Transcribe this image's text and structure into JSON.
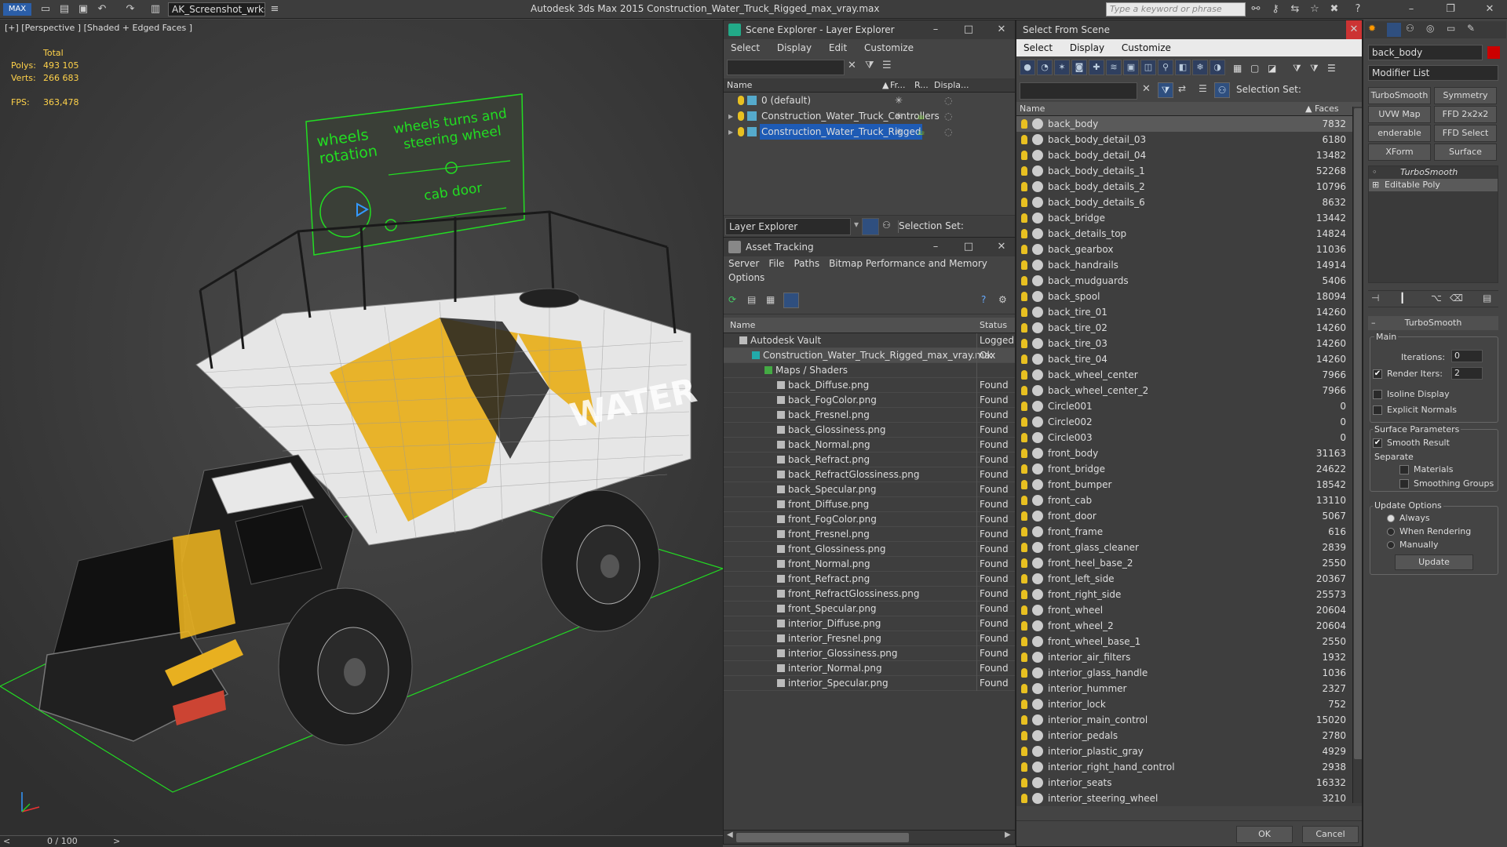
{
  "titlebar": {
    "workspace": "AK_Screenshot_wrksp",
    "app_title": "Autodesk 3ds Max  2015     Construction_Water_Truck_Rigged_max_vray.max",
    "search_placeholder": "Type a keyword or phrase"
  },
  "viewport": {
    "label": "[+] [Perspective ] [Shaded + Edged Faces ]",
    "stats": {
      "total_label": "Total",
      "polys_label": "Polys:",
      "polys": "493 105",
      "verts_label": "Verts:",
      "verts": "266 683",
      "fps_label": "FPS:",
      "fps": "363,478"
    },
    "panel_texts": {
      "wheels_rotation": "wheels rotation",
      "wheels_turns": "wheels turns and steering wheel",
      "cab_door": "cab door"
    },
    "truck_label": "WATER"
  },
  "statusbar": {
    "frame": "0 / 100"
  },
  "scene_explorer": {
    "title": "Scene Explorer - Layer Explorer",
    "menu": [
      "Select",
      "Display",
      "Edit",
      "Customize"
    ],
    "columns": [
      "Name",
      "Fr...",
      "R...",
      "Displa..."
    ],
    "layers": [
      {
        "name": "0 (default)",
        "selected": false
      },
      {
        "name": "Construction_Water_Truck_Controllers",
        "selected": false
      },
      {
        "name": "Construction_Water_Truck_Rigged",
        "selected": true
      }
    ],
    "footer_dropdown": "Layer Explorer",
    "selection_set_label": "Selection Set:"
  },
  "asset_tracking": {
    "title": "Asset Tracking",
    "menu": [
      "Server",
      "File",
      "Paths",
      "Bitmap Performance and Memory",
      "Options"
    ],
    "columns": [
      "Name",
      "Status"
    ],
    "rows": [
      {
        "name": "Autodesk Vault",
        "status": "Logged",
        "indent": 1
      },
      {
        "name": "Construction_Water_Truck_Rigged_max_vray.max",
        "status": "Ok",
        "indent": 2
      },
      {
        "name": "Maps / Shaders",
        "status": "",
        "indent": 3
      },
      {
        "name": "back_Diffuse.png",
        "status": "Found",
        "indent": 4
      },
      {
        "name": "back_FogColor.png",
        "status": "Found",
        "indent": 4
      },
      {
        "name": "back_Fresnel.png",
        "status": "Found",
        "indent": 4
      },
      {
        "name": "back_Glossiness.png",
        "status": "Found",
        "indent": 4
      },
      {
        "name": "back_Normal.png",
        "status": "Found",
        "indent": 4
      },
      {
        "name": "back_Refract.png",
        "status": "Found",
        "indent": 4
      },
      {
        "name": "back_RefractGlossiness.png",
        "status": "Found",
        "indent": 4
      },
      {
        "name": "back_Specular.png",
        "status": "Found",
        "indent": 4
      },
      {
        "name": "front_Diffuse.png",
        "status": "Found",
        "indent": 4
      },
      {
        "name": "front_FogColor.png",
        "status": "Found",
        "indent": 4
      },
      {
        "name": "front_Fresnel.png",
        "status": "Found",
        "indent": 4
      },
      {
        "name": "front_Glossiness.png",
        "status": "Found",
        "indent": 4
      },
      {
        "name": "front_Normal.png",
        "status": "Found",
        "indent": 4
      },
      {
        "name": "front_Refract.png",
        "status": "Found",
        "indent": 4
      },
      {
        "name": "front_RefractGlossiness.png",
        "status": "Found",
        "indent": 4
      },
      {
        "name": "front_Specular.png",
        "status": "Found",
        "indent": 4
      },
      {
        "name": "interior_Diffuse.png",
        "status": "Found",
        "indent": 4
      },
      {
        "name": "interior_Fresnel.png",
        "status": "Found",
        "indent": 4
      },
      {
        "name": "interior_Glossiness.png",
        "status": "Found",
        "indent": 4
      },
      {
        "name": "interior_Normal.png",
        "status": "Found",
        "indent": 4
      },
      {
        "name": "interior_Specular.png",
        "status": "Found",
        "indent": 4
      }
    ]
  },
  "select_from_scene": {
    "title": "Select From Scene",
    "menu": [
      "Select",
      "Display",
      "Customize"
    ],
    "selection_set_label": "Selection Set:",
    "columns": [
      "Name",
      "Faces"
    ],
    "rows": [
      {
        "name": "back_body",
        "faces": "7832"
      },
      {
        "name": "back_body_detail_03",
        "faces": "6180"
      },
      {
        "name": "back_body_detail_04",
        "faces": "13482"
      },
      {
        "name": "back_body_details_1",
        "faces": "52268"
      },
      {
        "name": "back_body_details_2",
        "faces": "10796"
      },
      {
        "name": "back_body_details_6",
        "faces": "8632"
      },
      {
        "name": "back_bridge",
        "faces": "13442"
      },
      {
        "name": "back_details_top",
        "faces": "14824"
      },
      {
        "name": "back_gearbox",
        "faces": "11036"
      },
      {
        "name": "back_handrails",
        "faces": "14914"
      },
      {
        "name": "back_mudguards",
        "faces": "5406"
      },
      {
        "name": "back_spool",
        "faces": "18094"
      },
      {
        "name": "back_tire_01",
        "faces": "14260"
      },
      {
        "name": "back_tire_02",
        "faces": "14260"
      },
      {
        "name": "back_tire_03",
        "faces": "14260"
      },
      {
        "name": "back_tire_04",
        "faces": "14260"
      },
      {
        "name": "back_wheel_center",
        "faces": "7966"
      },
      {
        "name": "back_wheel_center_2",
        "faces": "7966"
      },
      {
        "name": "Circle001",
        "faces": "0"
      },
      {
        "name": "Circle002",
        "faces": "0"
      },
      {
        "name": "Circle003",
        "faces": "0"
      },
      {
        "name": "front_body",
        "faces": "31163"
      },
      {
        "name": "front_bridge",
        "faces": "24622"
      },
      {
        "name": "front_bumper",
        "faces": "18542"
      },
      {
        "name": "front_cab",
        "faces": "13110"
      },
      {
        "name": "front_door",
        "faces": "5067"
      },
      {
        "name": "front_frame",
        "faces": "616"
      },
      {
        "name": "front_glass_cleaner",
        "faces": "2839"
      },
      {
        "name": "front_heel_base_2",
        "faces": "2550"
      },
      {
        "name": "front_left_side",
        "faces": "20367"
      },
      {
        "name": "front_right_side",
        "faces": "25573"
      },
      {
        "name": "front_wheel",
        "faces": "20604"
      },
      {
        "name": "front_wheel_2",
        "faces": "20604"
      },
      {
        "name": "front_wheel_base_1",
        "faces": "2550"
      },
      {
        "name": "interior_air_filters",
        "faces": "1932"
      },
      {
        "name": "interior_glass_handle",
        "faces": "1036"
      },
      {
        "name": "interior_hummer",
        "faces": "2327"
      },
      {
        "name": "interior_lock",
        "faces": "752"
      },
      {
        "name": "interior_main_control",
        "faces": "15020"
      },
      {
        "name": "interior_pedals",
        "faces": "2780"
      },
      {
        "name": "interior_plastic_gray",
        "faces": "4929"
      },
      {
        "name": "interior_right_hand_control",
        "faces": "2938"
      },
      {
        "name": "interior_seats",
        "faces": "16332"
      },
      {
        "name": "interior_steering_wheel",
        "faces": "3210"
      }
    ],
    "ok_label": "OK",
    "cancel_label": "Cancel"
  },
  "command_panel": {
    "object_name": "back_body",
    "modifier_list": "Modifier List",
    "mod_buttons": [
      "TurboSmooth",
      "Symmetry",
      "UVW Map",
      "FFD 2x2x2",
      "enderable Spli",
      "FFD Select",
      "XForm",
      "Surface Select"
    ],
    "stack": [
      "TurboSmooth",
      "Editable Poly"
    ],
    "rollout_title": "TurboSmooth",
    "main_label": "Main",
    "iterations_label": "Iterations:",
    "iterations": "0",
    "render_iters_label": "Render Iters:",
    "render_iters": "2",
    "isoline_label": "Isoline Display",
    "explicit_normals_label": "Explicit Normals",
    "surface_params_label": "Surface Parameters",
    "smooth_result_label": "Smooth Result",
    "separate_label": "Separate",
    "materials_label": "Materials",
    "smoothing_groups_label": "Smoothing Groups",
    "update_options_label": "Update Options",
    "always_label": "Always",
    "when_rendering_label": "When Rendering",
    "manually_label": "Manually",
    "update_button": "Update"
  },
  "colors": {
    "accent_blue": "#1e5bb5",
    "bulb_yellow": "#e8c021",
    "truck_yellow": "#e8b020",
    "wire_green": "#22dd22"
  }
}
